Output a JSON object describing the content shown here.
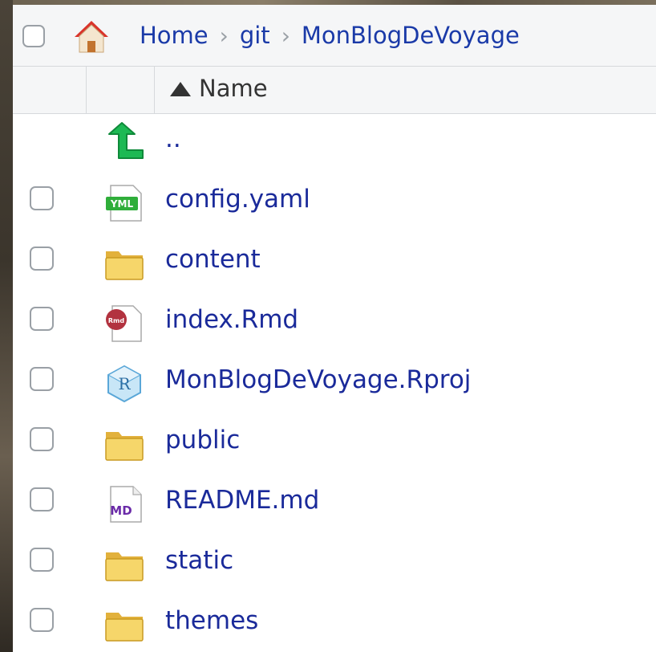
{
  "breadcrumb": {
    "home": "Home",
    "git": "git",
    "current": "MonBlogDeVoyage",
    "separator": "›"
  },
  "columns": {
    "name": "Name",
    "sort_indicator": "ascending"
  },
  "parent": {
    "label": "..",
    "icon": "up-arrow-icon"
  },
  "files": [
    {
      "name": "config.yaml",
      "icon": "yaml-file-icon"
    },
    {
      "name": "content",
      "icon": "folder-icon"
    },
    {
      "name": "index.Rmd",
      "icon": "rmd-file-icon"
    },
    {
      "name": "MonBlogDeVoyage.Rproj",
      "icon": "rproj-file-icon"
    },
    {
      "name": "public",
      "icon": "folder-icon"
    },
    {
      "name": "README.md",
      "icon": "markdown-file-icon"
    },
    {
      "name": "static",
      "icon": "folder-icon"
    },
    {
      "name": "themes",
      "icon": "folder-icon"
    }
  ],
  "colors": {
    "link": "#1a2a9a",
    "header_bg": "#f5f6f7",
    "folder": "#f0c94a",
    "up_arrow": "#1db954"
  }
}
